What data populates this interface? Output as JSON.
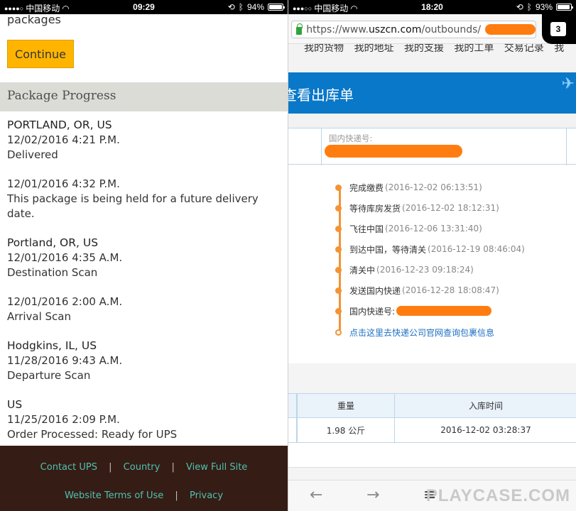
{
  "left": {
    "status": {
      "carrier": "中国移动",
      "time": "09:29",
      "battery": "94%",
      "battery_level": 0.94
    },
    "cut_text": "packages",
    "continue_label": "Continue",
    "progress_title": "Package Progress",
    "events": [
      {
        "location": "PORTLAND, OR, US",
        "datetime": "12/02/2016 4:21 P.M.",
        "activity": "Delivered"
      },
      {
        "location": "",
        "datetime": "12/01/2016 4:32 P.M.",
        "activity": "This package is being held for a future delivery date."
      },
      {
        "location": "Portland, OR, US",
        "datetime": "12/01/2016 4:35 A.M.",
        "activity": "Destination Scan"
      },
      {
        "location": "",
        "datetime": "12/01/2016 2:00 A.M.",
        "activity": "Arrival Scan"
      },
      {
        "location": "Hodgkins, IL, US",
        "datetime": "11/28/2016 9:43 A.M.",
        "activity": "Departure Scan"
      },
      {
        "location": "US",
        "datetime": "11/25/2016 2:09 P.M.",
        "activity": "Order Processed: Ready for UPS"
      }
    ],
    "footer": {
      "contact": "Contact UPS",
      "country": "Country",
      "full_site": "View Full Site",
      "terms": "Website Terms of Use",
      "privacy": "Privacy",
      "sep": "|"
    }
  },
  "right": {
    "status": {
      "carrier": "中国移动",
      "time": "18:20",
      "battery": "93%",
      "battery_level": 0.93
    },
    "url_prefix": "https://www.",
    "url_domain": "uszcn.com",
    "url_path": "/outbounds/",
    "tab_count": "3",
    "nav_items": "我的货物 我的地址 我的支援 我的工单 交易记录 我",
    "page_title": "查看出库单",
    "domestic_label": "国内快递号:",
    "timeline": [
      {
        "status": "完成缴费",
        "time": "(2016-12-02 06:13:51)"
      },
      {
        "status": "等待库房发货",
        "time": "(2016-12-02 18:12:31)"
      },
      {
        "status": "飞往中国",
        "time": "(2016-12-06 13:31:40)"
      },
      {
        "status": "到达中国，等待清关",
        "time": "(2016-12-19 08:46:04)"
      },
      {
        "status": "清关中",
        "time": "(2016-12-23 09:18:24)"
      },
      {
        "status": "发送国内快递",
        "time": "(2016-12-28 18:08:47)"
      },
      {
        "status": "国内快递号:",
        "time": ""
      }
    ],
    "timeline_link": "点击这里去快递公司官网查询包裹信息",
    "table": {
      "headers": [
        "重量",
        "入库时间"
      ],
      "row": [
        "1.98 公斤",
        "2016-12-02 03:28:37"
      ]
    },
    "watermark": "PLAYCASE.COM"
  },
  "colors": {
    "ups_brown": "#351c15",
    "ups_gold": "#ffb500",
    "ups_link": "#4ec2b0",
    "uszcn_blue": "#0a78c8",
    "timeline_orange": "#f39333",
    "redaction": "#ff7d10"
  }
}
